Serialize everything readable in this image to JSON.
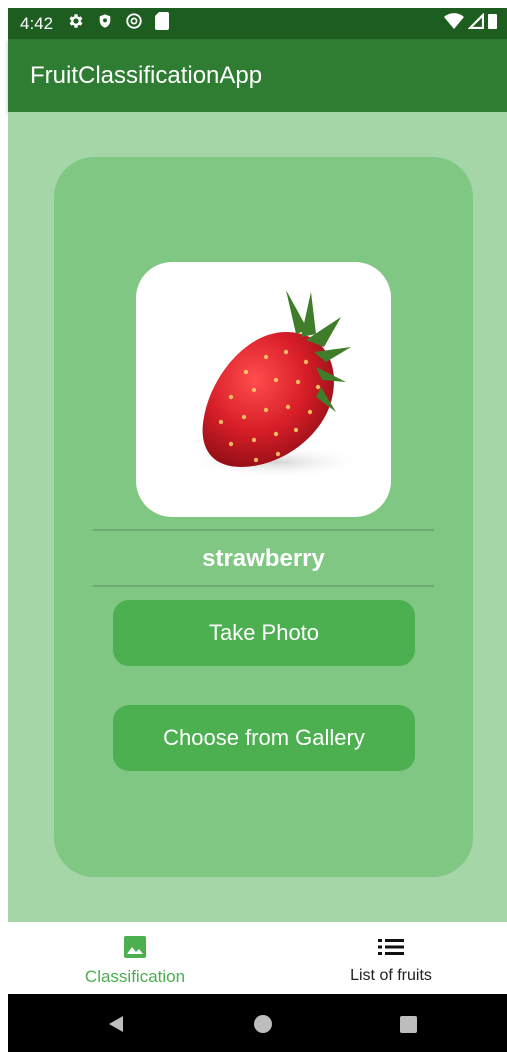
{
  "status_bar": {
    "time": "4:42",
    "icons": [
      "gear-icon",
      "shield-icon",
      "data-saver-icon",
      "sd-card-icon"
    ],
    "right_icons": [
      "wifi-icon",
      "signal-icon",
      "battery-icon"
    ]
  },
  "app_bar": {
    "title": "FruitClassificationApp"
  },
  "classification": {
    "photo_icon": "strawberry-photo",
    "result_label": "strawberry"
  },
  "buttons": {
    "take_photo": "Take Photo",
    "choose_gallery": "Choose from Gallery"
  },
  "bottom_nav": {
    "items": [
      {
        "label": "Classification",
        "icon": "image-icon",
        "active": true
      },
      {
        "label": "List of fruits",
        "icon": "list-icon",
        "active": false
      }
    ]
  },
  "system_nav": {
    "icons": [
      "back-icon",
      "home-icon",
      "recents-icon"
    ]
  },
  "colors": {
    "status_bar": "#1d5e20",
    "app_bar": "#2e7d32",
    "background": "#a5d6a7",
    "card": "#81c784",
    "button": "#4caf50",
    "active_tab": "#4caf50"
  }
}
